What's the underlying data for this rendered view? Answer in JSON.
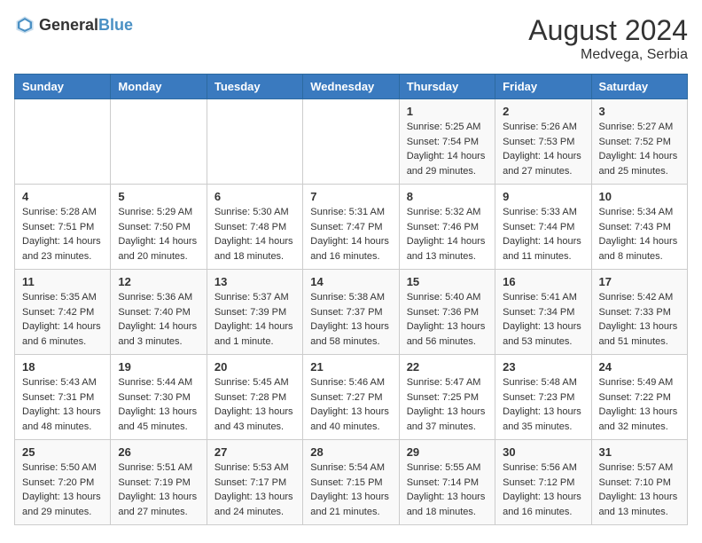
{
  "header": {
    "logo_general": "General",
    "logo_blue": "Blue",
    "month_year": "August 2024",
    "location": "Medvega, Serbia"
  },
  "days_of_week": [
    "Sunday",
    "Monday",
    "Tuesday",
    "Wednesday",
    "Thursday",
    "Friday",
    "Saturday"
  ],
  "weeks": [
    [
      {
        "day": "",
        "content": ""
      },
      {
        "day": "",
        "content": ""
      },
      {
        "day": "",
        "content": ""
      },
      {
        "day": "",
        "content": ""
      },
      {
        "day": "1",
        "content": "Sunrise: 5:25 AM\nSunset: 7:54 PM\nDaylight: 14 hours\nand 29 minutes."
      },
      {
        "day": "2",
        "content": "Sunrise: 5:26 AM\nSunset: 7:53 PM\nDaylight: 14 hours\nand 27 minutes."
      },
      {
        "day": "3",
        "content": "Sunrise: 5:27 AM\nSunset: 7:52 PM\nDaylight: 14 hours\nand 25 minutes."
      }
    ],
    [
      {
        "day": "4",
        "content": "Sunrise: 5:28 AM\nSunset: 7:51 PM\nDaylight: 14 hours\nand 23 minutes."
      },
      {
        "day": "5",
        "content": "Sunrise: 5:29 AM\nSunset: 7:50 PM\nDaylight: 14 hours\nand 20 minutes."
      },
      {
        "day": "6",
        "content": "Sunrise: 5:30 AM\nSunset: 7:48 PM\nDaylight: 14 hours\nand 18 minutes."
      },
      {
        "day": "7",
        "content": "Sunrise: 5:31 AM\nSunset: 7:47 PM\nDaylight: 14 hours\nand 16 minutes."
      },
      {
        "day": "8",
        "content": "Sunrise: 5:32 AM\nSunset: 7:46 PM\nDaylight: 14 hours\nand 13 minutes."
      },
      {
        "day": "9",
        "content": "Sunrise: 5:33 AM\nSunset: 7:44 PM\nDaylight: 14 hours\nand 11 minutes."
      },
      {
        "day": "10",
        "content": "Sunrise: 5:34 AM\nSunset: 7:43 PM\nDaylight: 14 hours\nand 8 minutes."
      }
    ],
    [
      {
        "day": "11",
        "content": "Sunrise: 5:35 AM\nSunset: 7:42 PM\nDaylight: 14 hours\nand 6 minutes."
      },
      {
        "day": "12",
        "content": "Sunrise: 5:36 AM\nSunset: 7:40 PM\nDaylight: 14 hours\nand 3 minutes."
      },
      {
        "day": "13",
        "content": "Sunrise: 5:37 AM\nSunset: 7:39 PM\nDaylight: 14 hours\nand 1 minute."
      },
      {
        "day": "14",
        "content": "Sunrise: 5:38 AM\nSunset: 7:37 PM\nDaylight: 13 hours\nand 58 minutes."
      },
      {
        "day": "15",
        "content": "Sunrise: 5:40 AM\nSunset: 7:36 PM\nDaylight: 13 hours\nand 56 minutes."
      },
      {
        "day": "16",
        "content": "Sunrise: 5:41 AM\nSunset: 7:34 PM\nDaylight: 13 hours\nand 53 minutes."
      },
      {
        "day": "17",
        "content": "Sunrise: 5:42 AM\nSunset: 7:33 PM\nDaylight: 13 hours\nand 51 minutes."
      }
    ],
    [
      {
        "day": "18",
        "content": "Sunrise: 5:43 AM\nSunset: 7:31 PM\nDaylight: 13 hours\nand 48 minutes."
      },
      {
        "day": "19",
        "content": "Sunrise: 5:44 AM\nSunset: 7:30 PM\nDaylight: 13 hours\nand 45 minutes."
      },
      {
        "day": "20",
        "content": "Sunrise: 5:45 AM\nSunset: 7:28 PM\nDaylight: 13 hours\nand 43 minutes."
      },
      {
        "day": "21",
        "content": "Sunrise: 5:46 AM\nSunset: 7:27 PM\nDaylight: 13 hours\nand 40 minutes."
      },
      {
        "day": "22",
        "content": "Sunrise: 5:47 AM\nSunset: 7:25 PM\nDaylight: 13 hours\nand 37 minutes."
      },
      {
        "day": "23",
        "content": "Sunrise: 5:48 AM\nSunset: 7:23 PM\nDaylight: 13 hours\nand 35 minutes."
      },
      {
        "day": "24",
        "content": "Sunrise: 5:49 AM\nSunset: 7:22 PM\nDaylight: 13 hours\nand 32 minutes."
      }
    ],
    [
      {
        "day": "25",
        "content": "Sunrise: 5:50 AM\nSunset: 7:20 PM\nDaylight: 13 hours\nand 29 minutes."
      },
      {
        "day": "26",
        "content": "Sunrise: 5:51 AM\nSunset: 7:19 PM\nDaylight: 13 hours\nand 27 minutes."
      },
      {
        "day": "27",
        "content": "Sunrise: 5:53 AM\nSunset: 7:17 PM\nDaylight: 13 hours\nand 24 minutes."
      },
      {
        "day": "28",
        "content": "Sunrise: 5:54 AM\nSunset: 7:15 PM\nDaylight: 13 hours\nand 21 minutes."
      },
      {
        "day": "29",
        "content": "Sunrise: 5:55 AM\nSunset: 7:14 PM\nDaylight: 13 hours\nand 18 minutes."
      },
      {
        "day": "30",
        "content": "Sunrise: 5:56 AM\nSunset: 7:12 PM\nDaylight: 13 hours\nand 16 minutes."
      },
      {
        "day": "31",
        "content": "Sunrise: 5:57 AM\nSunset: 7:10 PM\nDaylight: 13 hours\nand 13 minutes."
      }
    ]
  ]
}
